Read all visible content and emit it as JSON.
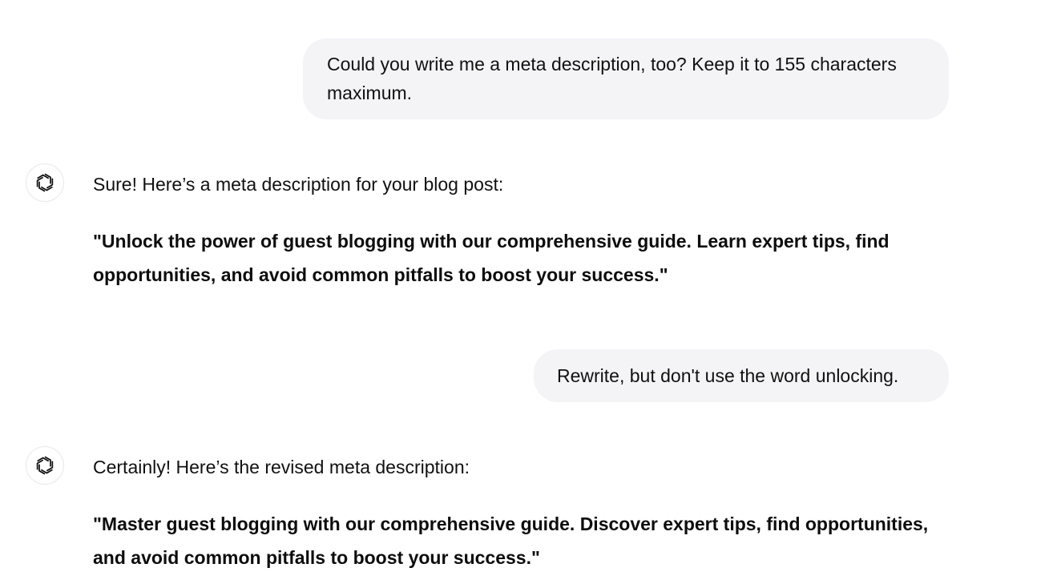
{
  "conversation": {
    "messages": [
      {
        "role": "user",
        "text": "Could you write me a meta description, too? Keep it to 155 characters maximum."
      },
      {
        "role": "assistant",
        "avatar_icon": "openai-logo-icon",
        "lead": "Sure! Here’s a meta description for your blog post:",
        "quote": "\"Unlock the power of guest blogging with our comprehensive guide. Learn expert tips, find opportunities, and avoid common pitfalls to boost your success.\""
      },
      {
        "role": "user",
        "text": "Rewrite, but don't use the word unlocking."
      },
      {
        "role": "assistant",
        "avatar_icon": "openai-logo-icon",
        "lead": "Certainly! Here’s the revised meta description:",
        "quote": "\"Master guest blogging with our comprehensive guide. Discover expert tips, find opportunities, and avoid common pitfalls to boost your success.\""
      }
    ]
  },
  "colors": {
    "user_bubble_bg": "#f4f3f6",
    "text": "#0d0d0d",
    "avatar_border": "#e8e8ea"
  }
}
